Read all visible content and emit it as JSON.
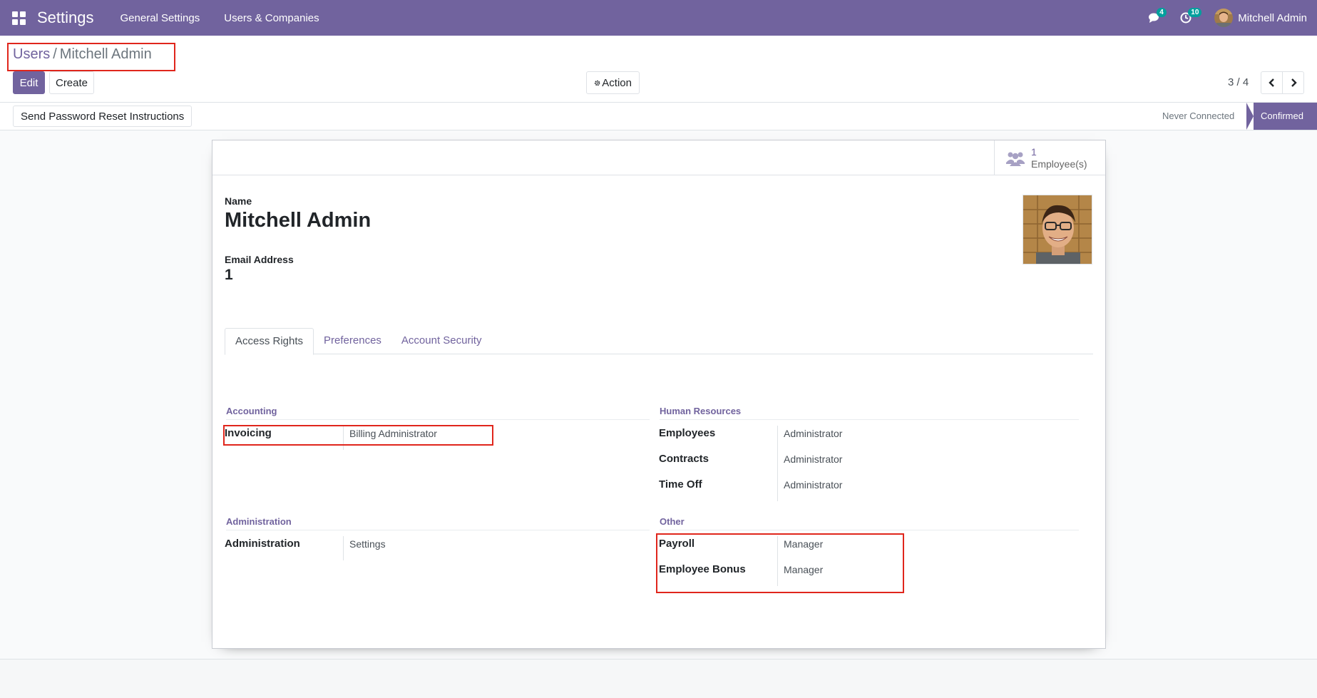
{
  "navbar": {
    "app_title": "Settings",
    "menus": [
      "General Settings",
      "Users & Companies"
    ],
    "messages_badge": "4",
    "activities_badge": "10",
    "user_name": "Mitchell Admin",
    "accent_color": "#71639e",
    "badge_color": "#00a09d"
  },
  "breadcrumb": {
    "parent": "Users",
    "separator": "/",
    "current": "Mitchell Admin"
  },
  "control_panel": {
    "edit_label": "Edit",
    "create_label": "Create",
    "action_label": "Action",
    "action_icon": "gear-icon",
    "pager_value": "3 / 4"
  },
  "statusbar": {
    "reset_button_label": "Send Password Reset Instructions",
    "stages": [
      {
        "label": "Never Connected",
        "active": false
      },
      {
        "label": "Confirmed",
        "active": true
      }
    ]
  },
  "stat_button": {
    "icon": "users-icon",
    "value": "1",
    "label": "Employee(s)"
  },
  "form": {
    "name_label": "Name",
    "name_value": "Mitchell Admin",
    "email_label": "Email Address",
    "email_value": "1"
  },
  "tabs": [
    {
      "label": "Access Rights",
      "active": true
    },
    {
      "label": "Preferences",
      "active": false
    },
    {
      "label": "Account Security",
      "active": false
    }
  ],
  "access_rights": {
    "accounting": {
      "title": "Accounting",
      "rows": [
        {
          "label": "Invoicing",
          "value": "Billing Administrator"
        }
      ]
    },
    "human_resources": {
      "title": "Human Resources",
      "rows": [
        {
          "label": "Employees",
          "value": "Administrator"
        },
        {
          "label": "Contracts",
          "value": "Administrator"
        },
        {
          "label": "Time Off",
          "value": "Administrator"
        }
      ]
    },
    "administration": {
      "title": "Administration",
      "rows": [
        {
          "label": "Administration",
          "value": "Settings"
        }
      ]
    },
    "other": {
      "title": "Other",
      "rows": [
        {
          "label": "Payroll",
          "value": "Manager"
        },
        {
          "label": "Employee Bonus",
          "value": "Manager"
        }
      ]
    }
  },
  "highlight_color": "#e0261c"
}
